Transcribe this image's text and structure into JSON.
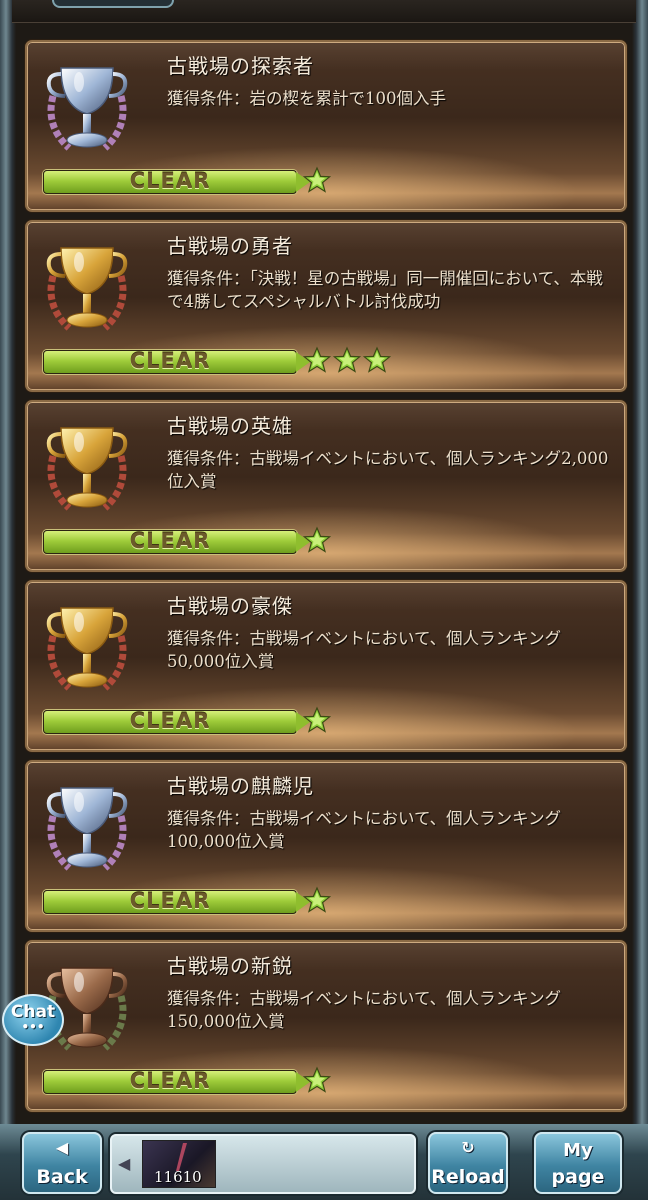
{
  "achievements": [
    {
      "title": "古戦場の探索者",
      "condition": "獲得条件：岩の楔を累計で100個入手",
      "status": "CLEAR",
      "stars": 1,
      "trophy": "silver"
    },
    {
      "title": "古戦場の勇者",
      "condition": "獲得条件：「決戦！星の古戦場」同一開催回において、本戦で4勝してスペシャルバトル討伐成功",
      "status": "CLEAR",
      "stars": 3,
      "trophy": "gold"
    },
    {
      "title": "古戦場の英雄",
      "condition": "獲得条件：古戦場イベントにおいて、個人ランキング2,000位入賞",
      "status": "CLEAR",
      "stars": 1,
      "trophy": "gold"
    },
    {
      "title": "古戦場の豪傑",
      "condition": "獲得条件：古戦場イベントにおいて、個人ランキング50,000位入賞",
      "status": "CLEAR",
      "stars": 1,
      "trophy": "gold"
    },
    {
      "title": "古戦場の麒麟児",
      "condition": "獲得条件：古戦場イベントにおいて、個人ランキング100,000位入賞",
      "status": "CLEAR",
      "stars": 1,
      "trophy": "silver"
    },
    {
      "title": "古戦場の新鋭",
      "condition": "獲得条件：古戦場イベントにおいて、個人ランキング150,000位入賞",
      "status": "CLEAR",
      "stars": 1,
      "trophy": "bronze"
    }
  ],
  "chat": {
    "label": "Chat",
    "dots": "•••"
  },
  "nav": {
    "back_label": "Back",
    "reload_label": "Reload",
    "mypage_line1": "My",
    "mypage_line2": "page",
    "count": "11610"
  },
  "icons": {
    "star": "star-icon",
    "trophy": "trophy-icon",
    "back": "back-arrow-icon",
    "reload": "reload-icon",
    "chat": "chat-bubble-icon"
  },
  "colors": {
    "clear_bar": "#9fcc3a",
    "star": "#8fcf3a",
    "card": "#3b281b"
  }
}
